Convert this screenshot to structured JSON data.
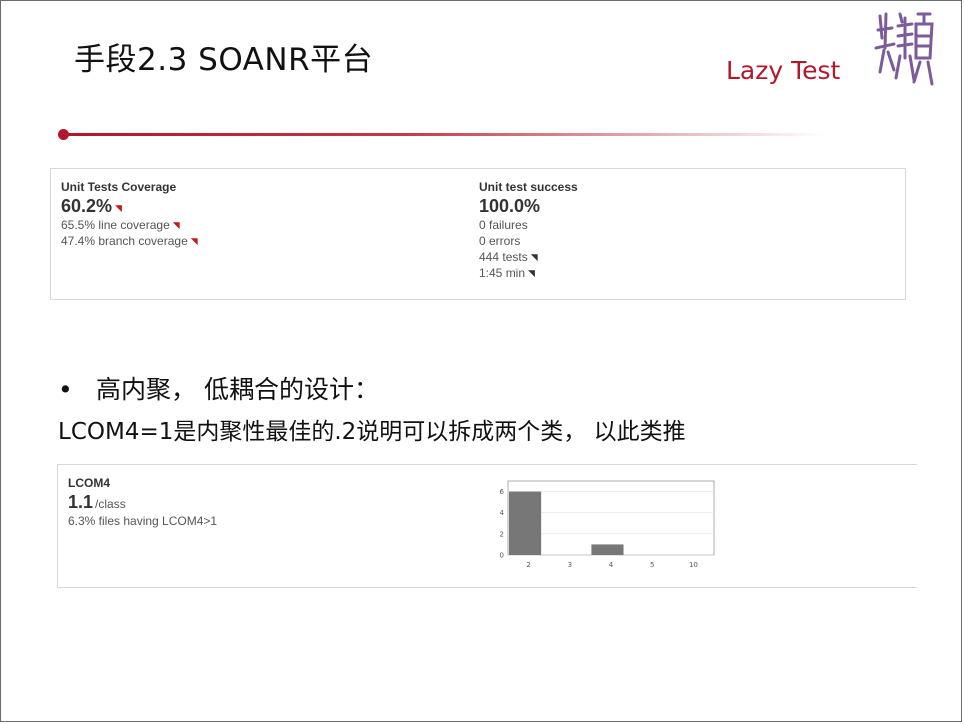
{
  "slide": {
    "title": "手段2.3 SOANR平台",
    "brand": "Lazy Test",
    "brand_color": "#b0182c",
    "seal_icon": "seal-calligraphy-icon"
  },
  "coverage_widget": {
    "unit_tests_coverage": {
      "title": "Unit Tests Coverage",
      "value": "60.2%",
      "line_coverage": "65.5% line coverage",
      "branch_coverage": "47.4% branch coverage",
      "trend_icon": "trend-down-red-icon"
    },
    "unit_test_success": {
      "title": "Unit test success",
      "value": "100.0%",
      "failures": "0 failures",
      "errors": "0 errors",
      "tests": "444 tests",
      "duration": "1:45 min",
      "trend_icon": "trend-down-gray-icon"
    }
  },
  "bullet": {
    "text": "高内聚， 低耦合的设计："
  },
  "explanation": "LCOM4=1是内聚性最佳的.2说明可以拆成两个类， 以此类推",
  "lcom_widget": {
    "title": "LCOM4",
    "value": "1.1",
    "unit": "/class",
    "detail": "6.3% files having LCOM4>1"
  },
  "chart_data": {
    "type": "bar",
    "categories": [
      "2",
      "3",
      "4",
      "5",
      "10"
    ],
    "values": [
      6,
      0,
      1,
      0,
      0
    ],
    "ylim": [
      0,
      7
    ],
    "yticks": [
      "0",
      "2",
      "4",
      "6"
    ],
    "grid": true,
    "bar_color": "#777777"
  }
}
